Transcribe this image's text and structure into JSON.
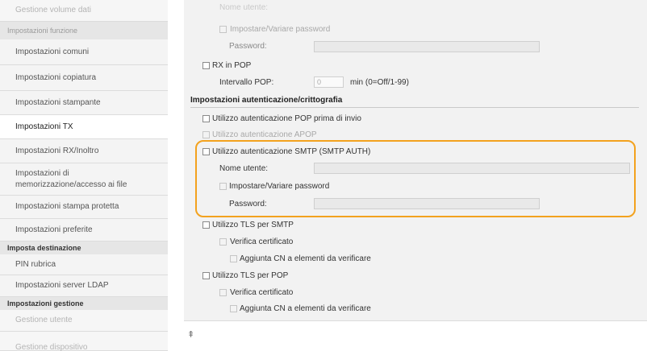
{
  "sidebar": {
    "top_item": "Gestione volume dati",
    "section_function": "Impostazioni funzione",
    "items": [
      "Impostazioni comuni",
      "Impostazioni copiatura",
      "Impostazioni stampante",
      "Impostazioni TX",
      "Impostazioni RX/Inoltro",
      "Impostazioni di memorizzazione/accesso ai file",
      "Impostazioni stampa protetta",
      "Impostazioni preferite"
    ],
    "section_destination": "Imposta destinazione",
    "destination_items": [
      "PIN rubrica",
      "Impostazioni server LDAP"
    ],
    "section_management": "Impostazioni gestione",
    "management_items": [
      "Gestione utente",
      "Gestione dispositivo"
    ]
  },
  "main": {
    "top_faded_label": "Nome utente:",
    "pop_set_change_password": "Impostare/Variare password",
    "pop_password_label": "Password:",
    "rx_pop_label": "RX in POP",
    "interval_label": "Intervallo POP:",
    "interval_value": "0",
    "interval_unit": "min (0=Off/1-99)",
    "auth_section_title": "Impostazioni autenticazione/crittografia",
    "use_pop_auth_before_send": "Utilizzo autenticazione POP prima di invio",
    "use_apop": "Utilizzo autenticazione APOP",
    "use_smtp_auth": "Utilizzo autenticazione SMTP (SMTP AUTH)",
    "smtp_username_label": "Nome utente:",
    "smtp_set_change_password": "Impostare/Variare password",
    "smtp_password_label": "Password:",
    "use_tls_smtp": "Utilizzo TLS per SMTP",
    "verify_cert_smtp": "Verifica certificato",
    "add_cn_smtp": "Aggiunta CN a elementi da verificare",
    "use_tls_pop": "Utilizzo TLS per POP",
    "verify_cert_pop": "Verifica certificato",
    "add_cn_pop": "Aggiunta CN a elementi da verificare"
  },
  "footer": {
    "scroll_top_symbol": "⇞"
  },
  "colors": {
    "highlight": "#f3a21e",
    "sidebar_bg": "#eeeeee",
    "main_bg": "#f2f2f2"
  }
}
